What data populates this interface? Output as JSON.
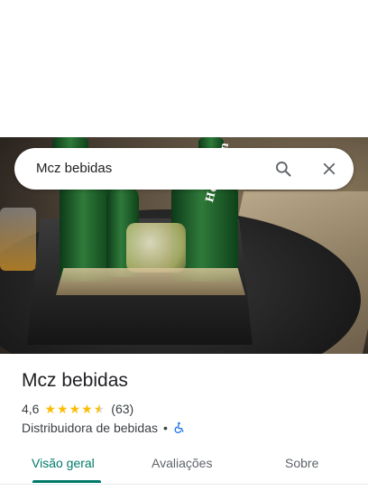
{
  "search": {
    "query": "Mcz bebidas"
  },
  "photo": {
    "brand_text": "Heineken"
  },
  "place": {
    "name": "Mcz bebidas",
    "rating": "4,6",
    "review_count": "(63)",
    "category": "Distribuidora de bebidas",
    "separator": "•"
  },
  "tabs": [
    {
      "label": "Visão geral",
      "active": true
    },
    {
      "label": "Avaliações",
      "active": false
    },
    {
      "label": "Sobre",
      "active": false
    }
  ],
  "colors": {
    "accent": "#00796b",
    "star": "#fbbc04",
    "accessibility": "#1a73e8"
  },
  "icons": [
    "search-icon",
    "close-icon",
    "star-icon",
    "wheelchair-icon"
  ]
}
